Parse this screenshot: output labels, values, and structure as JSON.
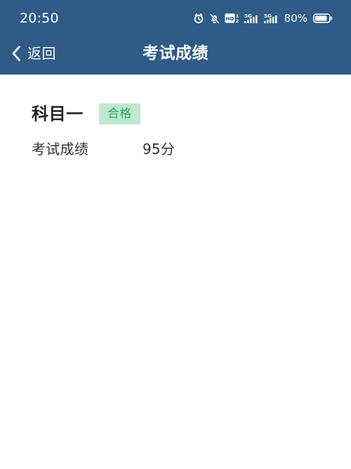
{
  "status_bar": {
    "time": "20:50",
    "battery_percent": "80%",
    "network_labels": [
      "5G",
      "5G"
    ],
    "hd_label": "HD",
    "sim_number": "1",
    "sim_number_secondary": "2",
    "icons": [
      "alarm-icon",
      "mute-bell-icon",
      "hd-icon",
      "signal-5g-icon",
      "signal-5g-icon",
      "battery-icon"
    ]
  },
  "nav": {
    "back_label": "返回",
    "title": "考试成绩",
    "back_icon": "chevron-left-icon"
  },
  "result": {
    "subject": "科目一",
    "status": "合格",
    "score_label": "考试成绩",
    "score_value": "95分"
  },
  "colors": {
    "header_bg": "#2f5b86",
    "badge_bg": "#bfe9ce",
    "badge_text": "#2ea55b"
  }
}
